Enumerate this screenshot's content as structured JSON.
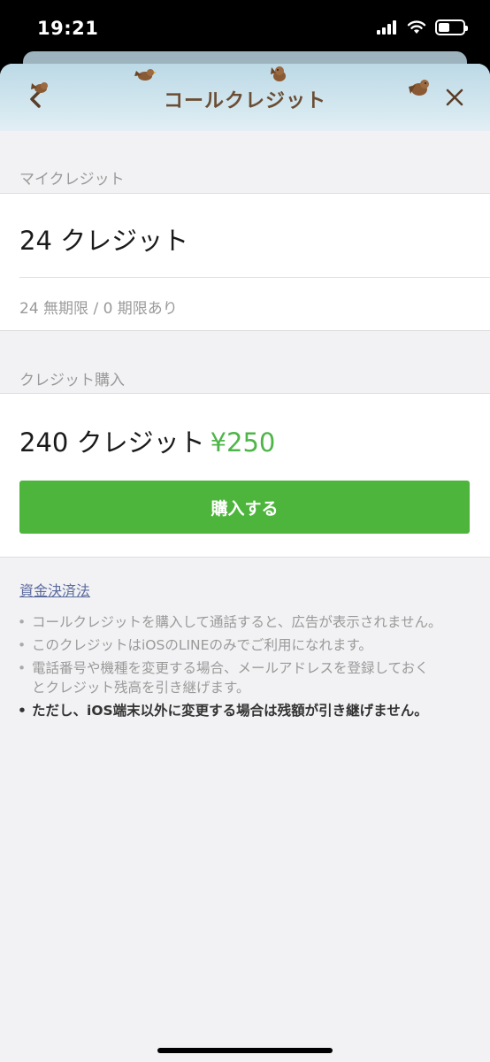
{
  "status_bar": {
    "time": "19:21",
    "battery_level": 0.45
  },
  "header": {
    "title": "コールクレジット"
  },
  "my_credit": {
    "section_label": "マイクレジット",
    "amount": "24 クレジット",
    "detail": "24 無期限 / 0 期限あり"
  },
  "purchase": {
    "section_label": "クレジット購入",
    "credit": "240 クレジット",
    "price": "¥250",
    "button_label": "購入する"
  },
  "info": {
    "law_link": "資金決済法",
    "notes": [
      "コールクレジットを購入して通話すると、広告が表示されません。",
      "このクレジットはiOSのLINEのみでご利用になれます。",
      "電話番号や機種を変更する場合、メールアドレスを登録しておくとクレジット残高を引き継げます。",
      "ただし、iOS端末以外に変更する場合は残額が引き継げません。"
    ]
  },
  "colors": {
    "accent_green": "#4eb53c",
    "title_brown": "#6b4d33",
    "link": "#5a6a9e"
  }
}
